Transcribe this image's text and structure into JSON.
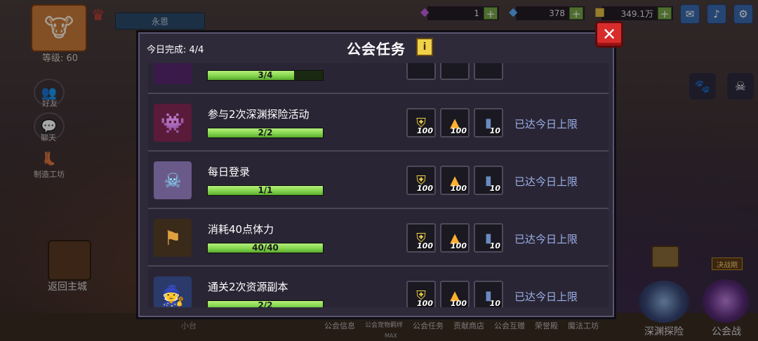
{
  "player": {
    "name": "永恩",
    "level": "等级: 60"
  },
  "resources": [
    {
      "icon": "purple-gem-icon",
      "value": "1"
    },
    {
      "icon": "blue-diamond-icon",
      "value": "378"
    },
    {
      "icon": "gold-coin-icon",
      "value": "349.1万"
    }
  ],
  "left_menu": {
    "friends": "好友",
    "chat": "聊天",
    "workshop": "制造工坊",
    "home": "返回主城"
  },
  "right_menu": {
    "abyss": "深渊探险",
    "guild_war": "公会战",
    "war_badge": "决战期"
  },
  "bottom_nav": [
    "公会信息",
    "公会宠物羁绊",
    "公会任务",
    "贡献商店",
    "公会互赠",
    "荣誉殿",
    "魔法工坊"
  ],
  "bottom_extra": {
    "max": "MAX",
    "left_label": "小台"
  },
  "modal": {
    "title": "公会任务",
    "today_label": "今日完成: 4/4",
    "partial_row_progress": "3/4",
    "tasks": [
      {
        "name": "参与2次深渊探险活动",
        "progress": "2/2",
        "fill": 1.0,
        "status": "已达今日上限",
        "icon": "abyss-portal-icon",
        "rewards": [
          {
            "icon": "guild-badge-icon",
            "amount": "100"
          },
          {
            "icon": "flame-icon",
            "amount": "100"
          },
          {
            "icon": "potion-icon",
            "amount": "10"
          }
        ]
      },
      {
        "name": "每日登录",
        "progress": "1/1",
        "fill": 1.0,
        "status": "已达今日上限",
        "icon": "skull-icon",
        "rewards": [
          {
            "icon": "guild-badge-icon",
            "amount": "100"
          },
          {
            "icon": "flame-icon",
            "amount": "100"
          },
          {
            "icon": "potion-icon",
            "amount": "10"
          }
        ]
      },
      {
        "name": "消耗40点体力",
        "progress": "40/40",
        "fill": 1.0,
        "status": "已达今日上限",
        "icon": "guild-banner-icon",
        "rewards": [
          {
            "icon": "guild-badge-icon",
            "amount": "100"
          },
          {
            "icon": "flame-icon",
            "amount": "100"
          },
          {
            "icon": "potion-icon",
            "amount": "10"
          }
        ]
      },
      {
        "name": "通关2次资源副本",
        "progress": "2/2",
        "fill": 1.0,
        "status": "已达今日上限",
        "icon": "wizard-icon",
        "rewards": [
          {
            "icon": "guild-badge-icon",
            "amount": "100"
          },
          {
            "icon": "flame-icon",
            "amount": "100"
          },
          {
            "icon": "potion-icon",
            "amount": "10"
          }
        ]
      }
    ]
  }
}
